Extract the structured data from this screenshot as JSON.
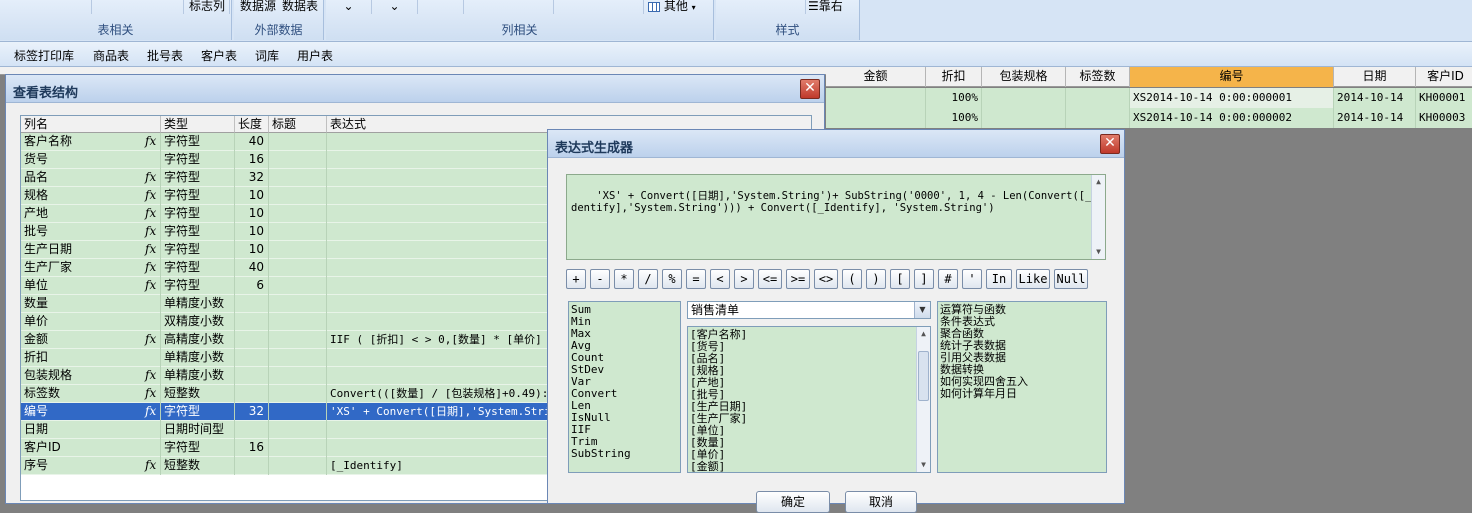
{
  "ribbon": {
    "groups": [
      {
        "caption": "表相关",
        "items": [
          "标志列"
        ]
      },
      {
        "caption": "外部数据",
        "items": [
          "数据源",
          "数据表"
        ]
      },
      {
        "caption": "列相关",
        "items": [
          "其他"
        ]
      },
      {
        "caption": "样式",
        "items": [
          "靠右"
        ]
      }
    ]
  },
  "tabs": [
    "标签打印库",
    "商品表",
    "批号表",
    "客户表",
    "词库",
    "用户表"
  ],
  "main_grid": {
    "headers": [
      "金额",
      "折扣",
      "包装规格",
      "标签数",
      "编号",
      "日期",
      "客户ID"
    ],
    "rows": [
      {
        "zhekou": "100%",
        "bianhao": "XS2014-10-14 0:00:000001",
        "riqi": "2014-10-14",
        "kehu": "KH00001"
      },
      {
        "zhekou": "100%",
        "bianhao": "XS2014-10-14 0:00:000002",
        "riqi": "2014-10-14",
        "kehu": "KH00003"
      }
    ]
  },
  "dialog1": {
    "title": "查看表结构",
    "headers": [
      "列名",
      "类型",
      "长度",
      "标题",
      "表达式"
    ],
    "rows": [
      {
        "name": "客户名称",
        "fx": true,
        "type": "字符型",
        "len": "40",
        "caption": "",
        "expr": ""
      },
      {
        "name": "货号",
        "fx": false,
        "type": "字符型",
        "len": "16",
        "caption": "",
        "expr": ""
      },
      {
        "name": "品名",
        "fx": true,
        "type": "字符型",
        "len": "32",
        "caption": "",
        "expr": ""
      },
      {
        "name": "规格",
        "fx": true,
        "type": "字符型",
        "len": "10",
        "caption": "",
        "expr": ""
      },
      {
        "name": "产地",
        "fx": true,
        "type": "字符型",
        "len": "10",
        "caption": "",
        "expr": ""
      },
      {
        "name": "批号",
        "fx": true,
        "type": "字符型",
        "len": "10",
        "caption": "",
        "expr": ""
      },
      {
        "name": "生产日期",
        "fx": true,
        "type": "字符型",
        "len": "10",
        "caption": "",
        "expr": ""
      },
      {
        "name": "生产厂家",
        "fx": true,
        "type": "字符型",
        "len": "40",
        "caption": "",
        "expr": ""
      },
      {
        "name": "单位",
        "fx": true,
        "type": "字符型",
        "len": "6",
        "caption": "",
        "expr": ""
      },
      {
        "name": "数量",
        "fx": false,
        "type": "单精度小数",
        "len": "",
        "caption": "",
        "expr": ""
      },
      {
        "name": "单价",
        "fx": false,
        "type": "双精度小数",
        "len": "",
        "caption": "",
        "expr": ""
      },
      {
        "name": "金额",
        "fx": true,
        "type": "高精度小数",
        "len": "",
        "caption": "",
        "expr": "IIF ( [折扣] < > 0,[数量] * [单价]"
      },
      {
        "name": "折扣",
        "fx": false,
        "type": "单精度小数",
        "len": "",
        "caption": "",
        "expr": ""
      },
      {
        "name": "包装规格",
        "fx": true,
        "type": "单精度小数",
        "len": "",
        "caption": "",
        "expr": ""
      },
      {
        "name": "标签数",
        "fx": true,
        "type": "短整数",
        "len": "",
        "caption": "",
        "expr": "Convert(([数量] / [包装规格]+0.49):"
      },
      {
        "name": "编号",
        "fx": true,
        "type": "字符型",
        "len": "32",
        "caption": "",
        "expr": "'XS' + Convert([日期],'System.String"
      },
      {
        "name": "日期",
        "fx": false,
        "type": "日期时间型",
        "len": "",
        "caption": "",
        "expr": ""
      },
      {
        "name": "客户ID",
        "fx": false,
        "type": "字符型",
        "len": "16",
        "caption": "",
        "expr": ""
      },
      {
        "name": "序号",
        "fx": true,
        "type": "短整数",
        "len": "",
        "caption": "",
        "expr": "[_Identify]"
      }
    ],
    "selected_index": 15
  },
  "dialog2": {
    "title": "表达式生成器",
    "expression": "'XS' + Convert([日期],'System.String')+ SubString('0000', 1, 4 - Len(Convert([_Identify],'System.String'))) + Convert([_Identify], 'System.String')",
    "operators": [
      "+",
      "-",
      "*",
      "/",
      "%",
      "=",
      "<",
      ">",
      "<=",
      ">=",
      "<>",
      "(",
      ")",
      "[",
      "]",
      "#",
      "'",
      "In",
      "Like",
      "Null"
    ],
    "functions": [
      "Sum",
      "Min",
      "Max",
      "Avg",
      "Count",
      "StDev",
      "Var",
      "Convert",
      "Len",
      "IsNull",
      "IIF",
      "Trim",
      "SubString"
    ],
    "table_select": "销售清单",
    "fields": [
      "[客户名称]",
      "[货号]",
      "[品名]",
      "[规格]",
      "[产地]",
      "[批号]",
      "[生产日期]",
      "[生产厂家]",
      "[单位]",
      "[数量]",
      "[单价]",
      "[金额]"
    ],
    "help_items": [
      "运算符与函数",
      "条件表达式",
      "聚合函数",
      "统计子表数据",
      "引用父表数据",
      "数据转换",
      "如何实现四舍五入",
      "如何计算年月日"
    ],
    "ok_label": "确定",
    "cancel_label": "取消"
  },
  "colors": {
    "row_green": "#cfe8cf",
    "selection_blue": "#3169c6",
    "header_orange": "#f5b44a"
  },
  "icons": {
    "close": "close-icon",
    "fx": "fx-icon",
    "dropdown": "chevron-down-icon"
  }
}
